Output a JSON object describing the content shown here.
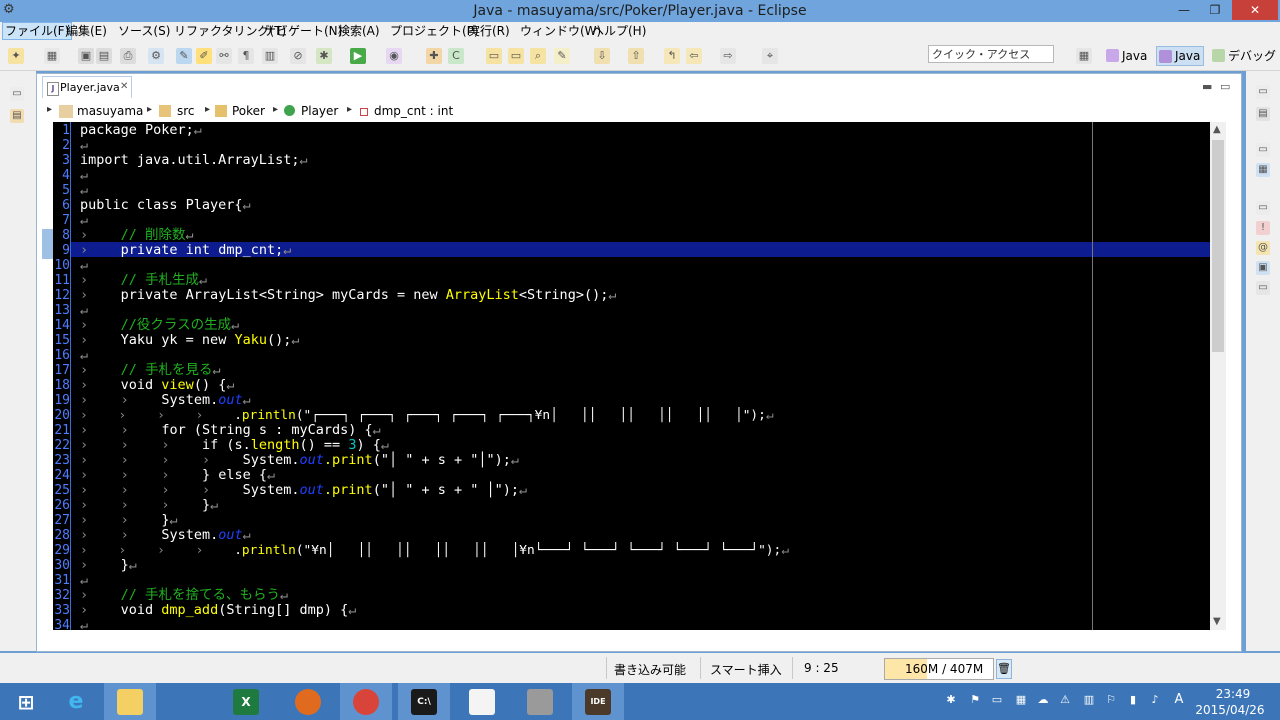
{
  "window": {
    "title": "Java - masuyama/src/Poker/Player.java - Eclipse",
    "minimize_glyph": "—",
    "maximize_glyph": "❐",
    "close_glyph": "✕"
  },
  "menu": [
    "ファイル(F)",
    "編集(E)",
    "ソース(S)",
    "リファクタリング(T)",
    "ナビゲート(N)",
    "検索(A)",
    "プロジェクト(P)",
    "実行(R)",
    "ウィンドウ(W)",
    "ヘルプ(H)"
  ],
  "toolbar": {
    "quick_access_placeholder": "クイック・アクセス",
    "perspectives": [
      "Java",
      "Java",
      "デバッグ"
    ]
  },
  "editor": {
    "tab_label": "Player.java",
    "tab_close": "✕",
    "tab_icon": "J",
    "breadcrumb": [
      "masuyama",
      "src",
      "Poker",
      "Player",
      "dmp_cnt : int"
    ],
    "breadcrumb_arrow": "▸",
    "line_numbers": [
      "1",
      "2",
      "3",
      "4",
      "5",
      "6",
      "7",
      "8",
      "9",
      "10",
      "11",
      "12",
      "13",
      "14",
      "15",
      "16",
      "17",
      "18",
      "19",
      "20",
      "21",
      "22",
      "23",
      "24",
      "25",
      "26",
      "27",
      "28",
      "29",
      "30",
      "31",
      "32",
      "33",
      "34"
    ],
    "code": {
      "l1": "package Poker;",
      "l3": "import java.util.ArrayList;",
      "l6": "public class Player{",
      "l8_comment": "// 削除数",
      "l9": "private int dmp_cnt;",
      "l11_comment": "// 手札生成",
      "l12_a": "private ArrayList<String> myCards = new ",
      "l12_b": "ArrayList",
      "l12_c": "<String>();",
      "l14_comment": "//役クラスの生成",
      "l15_a": "Yaku yk = new ",
      "l15_b": "Yaku",
      "l15_c": "();",
      "l17_comment": "// 手札を見る",
      "l18_a": "void ",
      "l18_b": "view",
      "l18_c": "() {",
      "l19_a": "System.",
      "l19_b": "out",
      "l20_a": ".",
      "l20_b": "println",
      "l20_c": "(\"┌───┐ ┌───┐ ┌───┐ ┌───┐ ┌───┐¥n│   ││   ││   ││   ││   │\");",
      "l21": "for (String s : myCards) {",
      "l22_a": "if (s.",
      "l22_b": "length",
      "l22_c": "() == ",
      "l22_d": "3",
      "l22_e": ") {",
      "l23_a": "System.",
      "l23_b": "out",
      "l23_c": ".print",
      "l23_d": "(\"│ \" + s + \"│\");",
      "l24": "} else {",
      "l25_a": "System.",
      "l25_b": "out",
      "l25_c": ".print",
      "l25_d": "(\"│ \" + s + \" │\");",
      "l26": "}",
      "l27": "}",
      "l28_a": "System.",
      "l28_b": "out",
      "l29_a": ".",
      "l29_b": "println",
      "l29_c": "(\"¥n│   ││   ││   ││   ││   │¥n└───┘ └───┘ └───┘ └───┘ └───┘\");",
      "l30": "}",
      "l32_comment": "// 手札を捨てる、もらう",
      "l33_a": "void ",
      "l33_b": "dmp_add",
      "l33_c": "(String[] dmp) {",
      "ret": "↵",
      "tab": "›"
    }
  },
  "status": {
    "write_mode": "書き込み可能",
    "insert_mode": "スマート挿入",
    "position": "9 : 25",
    "heap": "160M / 407M",
    "heap_fraction": 0.39
  },
  "taskbar": {
    "time": "23:49",
    "date": "2015/04/26",
    "ime": "A"
  }
}
